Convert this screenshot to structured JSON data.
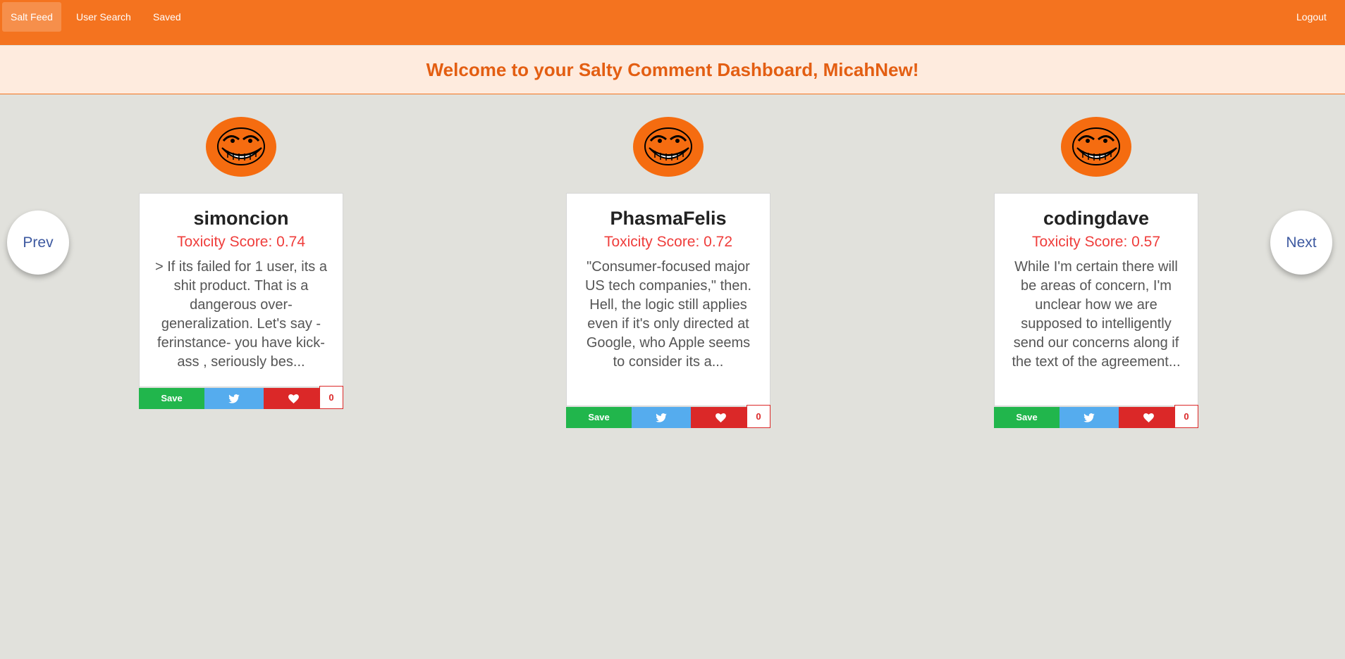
{
  "nav": {
    "salt_feed": "Salt Feed",
    "user_search": "User Search",
    "saved": "Saved",
    "logout": "Logout"
  },
  "banner": {
    "text": "Welcome to your Salty Comment Dashboard, MicahNew!"
  },
  "pager": {
    "prev": "Prev",
    "next": "Next"
  },
  "cards": [
    {
      "username": "simoncion",
      "score": "Toxicity Score: 0.74",
      "comment": "> If its failed for 1 user, its a shit product. That is a dangerous over-generalization. Let's say -ferinstance- you have kick-ass , seriously bes...",
      "save_label": "Save",
      "likes": "0"
    },
    {
      "username": "PhasmaFelis",
      "score": "Toxicity Score: 0.72",
      "comment": "\"Consumer-focused major US tech companies,\" then. Hell, the logic still applies even if it's only directed at Google, who Apple seems to consider its a...",
      "save_label": "Save",
      "likes": "0"
    },
    {
      "username": "codingdave",
      "score": "Toxicity Score: 0.57",
      "comment": "While I'm certain there will be areas of concern, I'm unclear how we are supposed to intelligently send our concerns along if the text of the agreement...",
      "save_label": "Save",
      "likes": "0"
    }
  ],
  "icons": {
    "avatar": "troll-face-icon",
    "tweet": "twitter-icon",
    "like": "heart-icon"
  },
  "colors": {
    "navbar": "#f4731f",
    "banner_bg": "#feebde",
    "banner_text": "#e35e12",
    "score": "#ef3d3b",
    "save": "#21b64c",
    "twitter": "#55acee",
    "like": "#db2828",
    "pager_text": "#3d59a0"
  }
}
